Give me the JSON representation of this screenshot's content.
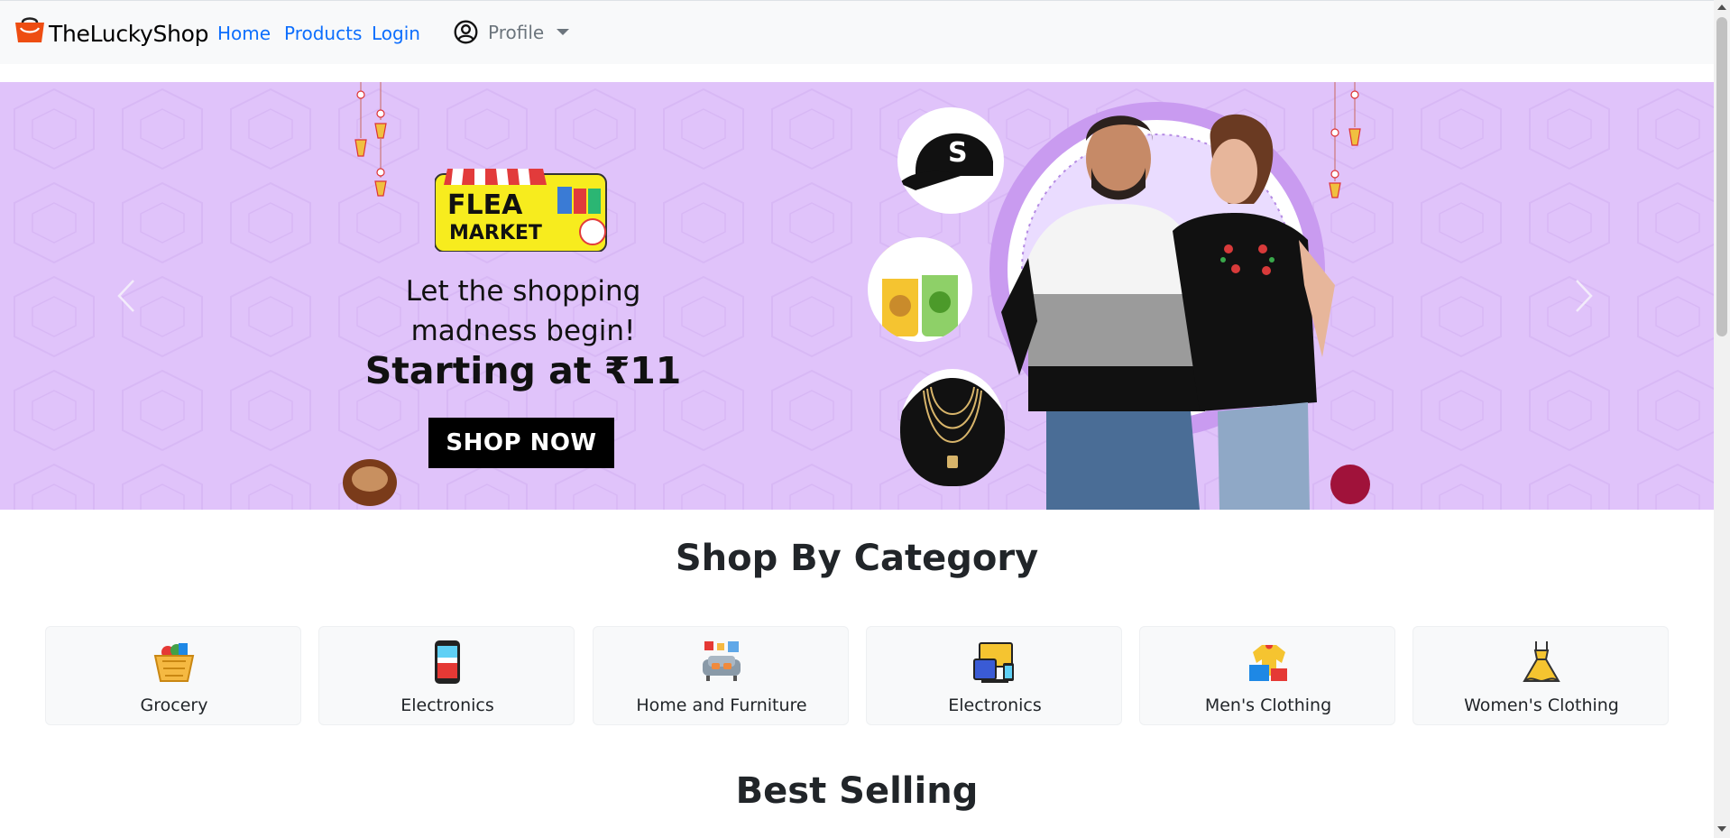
{
  "navbar": {
    "brand": "TheLuckyShop",
    "links": {
      "home": "Home",
      "products": "Products",
      "login": "Login"
    },
    "profile_label": "Profile"
  },
  "banner": {
    "logo_text_1": "FLEA",
    "logo_text_2": "MARKET",
    "line1": "Let the shopping",
    "line2": "madness begin!",
    "line3": "Starting at ₹11",
    "cta": "SHOP NOW",
    "cap_letter": "S",
    "background_color": "#e0c3fa"
  },
  "categories_section": {
    "title": "Shop By Category",
    "items": [
      {
        "label": "Grocery",
        "icon": "grocery-basket-icon"
      },
      {
        "label": "Electronics",
        "icon": "smartphone-icon"
      },
      {
        "label": "Home and Furniture",
        "icon": "sofa-icon"
      },
      {
        "label": "Electronics",
        "icon": "devices-icon"
      },
      {
        "label": "Men's Clothing",
        "icon": "mens-clothing-icon"
      },
      {
        "label": "Women's Clothing",
        "icon": "dress-icon"
      }
    ]
  },
  "best_selling_section": {
    "title": "Best Selling"
  },
  "colors": {
    "link": "#0d6efd",
    "navbar_bg": "#f8f9fa",
    "card_bg": "#f8f9fa"
  }
}
